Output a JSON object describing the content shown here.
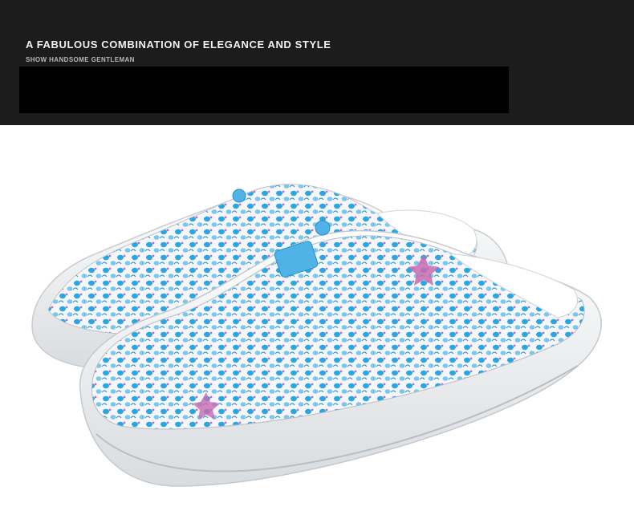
{
  "banner": {
    "headline": "A FABULOUS COMBINATION OF ELEGANCE AND STYLE",
    "subhead": "SHOW HANDSOME GENTLEMAN"
  },
  "colors": {
    "banner_bg": "#1c1c1c",
    "bar_bg": "#000000",
    "shoe_white": "#f4f5f7",
    "pattern_blue": "#2aa6e0",
    "pattern_pink": "#c86ab0"
  },
  "image": {
    "subject": "pair-of-white-perforated-clogs-with-blue-and-pink-floral-print"
  }
}
